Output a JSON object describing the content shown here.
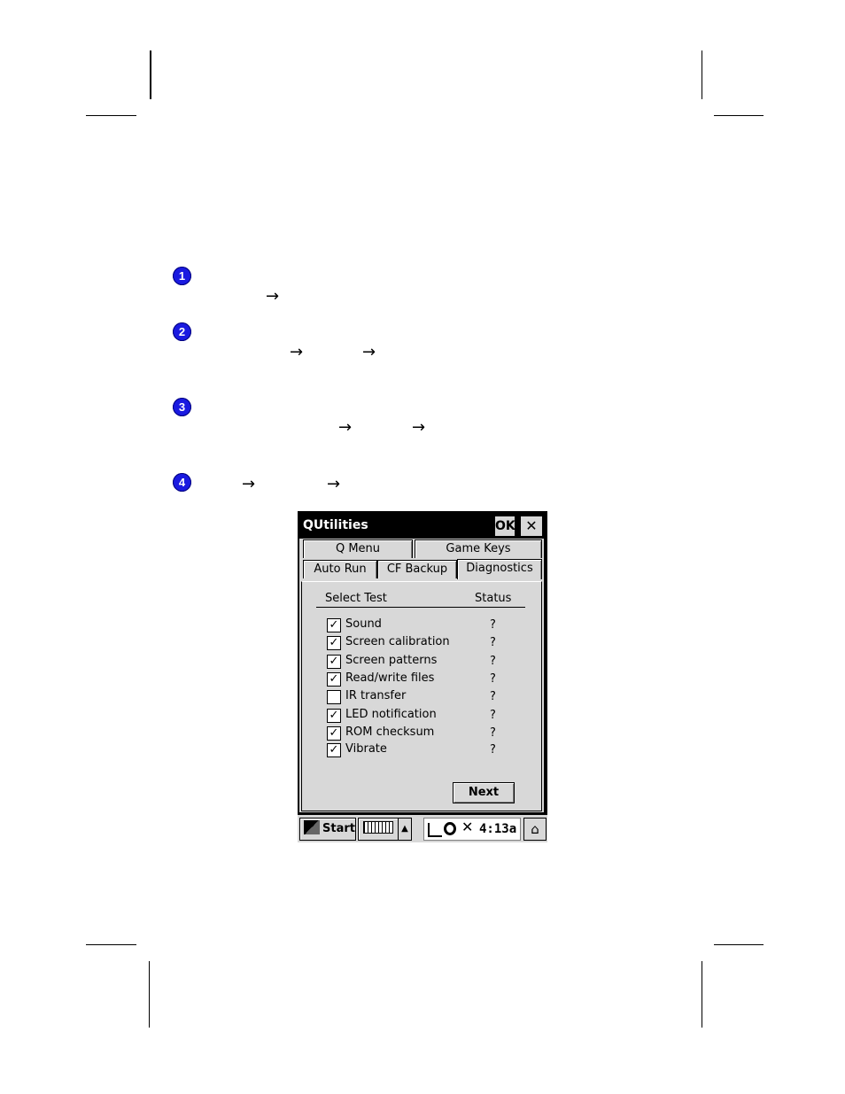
{
  "steps": [
    "1",
    "2",
    "3",
    "4"
  ],
  "arrow_glyph": "→",
  "window": {
    "title": "QUtilities",
    "ok_label": "OK",
    "close_glyph": "✕"
  },
  "tabs": {
    "row1": [
      "Q Menu",
      "Game Keys"
    ],
    "row2": [
      "Auto Run",
      "CF Backup",
      "Diagnostics"
    ],
    "active": "Diagnostics"
  },
  "diagnostics": {
    "header_test": "Select Test",
    "header_status": "Status",
    "tests": [
      {
        "label": "Sound",
        "checked": true,
        "status": "?"
      },
      {
        "label": "Screen calibration",
        "checked": true,
        "status": "?"
      },
      {
        "label": "Screen patterns",
        "checked": true,
        "status": "?"
      },
      {
        "label": "Read/write files",
        "checked": true,
        "status": "?"
      },
      {
        "label": "IR transfer",
        "checked": false,
        "status": "?"
      },
      {
        "label": "LED notification",
        "checked": true,
        "status": "?"
      },
      {
        "label": "ROM checksum",
        "checked": true,
        "status": "?"
      },
      {
        "label": "Vibrate",
        "checked": true,
        "status": "?"
      }
    ],
    "next_label": "Next"
  },
  "taskbar": {
    "start_label": "Start",
    "start_icon": "start-flag-icon",
    "keyboard_icon": "keyboard-icon",
    "up_glyph": "▲",
    "clock": "4:13a",
    "desktop_icon": "desktop-icon"
  }
}
